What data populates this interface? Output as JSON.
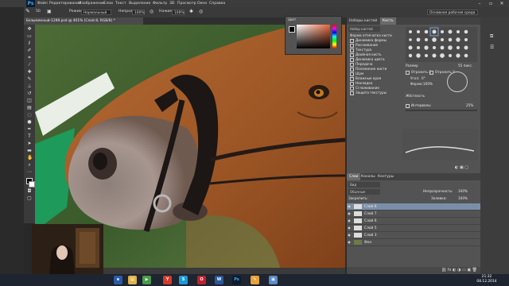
{
  "app": {
    "logo": "Ps"
  },
  "menu": [
    "Файл",
    "Редактирование",
    "Изображение",
    "Слои",
    "Текст",
    "Выделение",
    "Фильтр",
    "3D",
    "Просмотр",
    "Окно",
    "Справка"
  ],
  "workspace": "Основная рабочая среда",
  "options": {
    "mode_label": "Режим:",
    "mode_value": "Нормальный",
    "opacity_label": "Непрозр.:",
    "opacity_value": "100%",
    "press_label": "Нажим:",
    "press_value": "100%",
    "brush_size": "50"
  },
  "document": {
    "tab": "Безымянный-1289.psd @ 401% (Слой 8, RGB/8) *",
    "zoom": "400%",
    "status_doc": "Док: 24,9M/199,0M"
  },
  "color_panel": {
    "title": "Цвет"
  },
  "brush_panel": {
    "tabs": [
      "Наборы кистей",
      "Кисть"
    ],
    "options": [
      "Набор кистей",
      "Форма отпечатка кисти",
      "Динамика формы",
      "Рассеивание",
      "Текстура",
      "Двойная кисть",
      "Динамика цвета",
      "Передача",
      "Положение кисти",
      "Шум",
      "Влажные края",
      "Накладка",
      "Сглаживание",
      "Защита текстуры"
    ],
    "size_label": "Размер",
    "size_value": "55 пикс.",
    "angle_label": "Угол:",
    "angle_value": "0°",
    "round_label": "Форма:",
    "round_value": "100%",
    "hard_label": "Жёсткость",
    "spacing_label": "Интервалы",
    "spacing_value": "25%",
    "flip_x": "Отразить X",
    "flip_y": "Отразить Y"
  },
  "layers_panel": {
    "tabs": [
      "Слои",
      "Каналы",
      "Контуры"
    ],
    "kind": "Вид",
    "blend": "Обычные",
    "opacity_label": "Непрозрачность:",
    "opacity_value": "100%",
    "fill_label": "Заливка:",
    "fill_value": "100%",
    "lock_label": "Закрепить:",
    "layers": [
      "Слой 8",
      "Слой 7",
      "Слой 6",
      "Слой 5",
      "Слой 3",
      "Фон"
    ],
    "selected_index": 0
  },
  "taskbar": {
    "time": "21:32",
    "date": "08.12.2014",
    "apps": [
      "ie-icon",
      "folder-icon",
      "media-icon",
      "yandex-icon",
      "skype-icon",
      "opera-icon",
      "word-icon",
      "photoshop-icon",
      "paint-icon",
      "image-icon"
    ]
  },
  "colors": {
    "accent": "#e8663d",
    "selection": "#7a8ea8",
    "ps_blue": "#41a8f5"
  }
}
